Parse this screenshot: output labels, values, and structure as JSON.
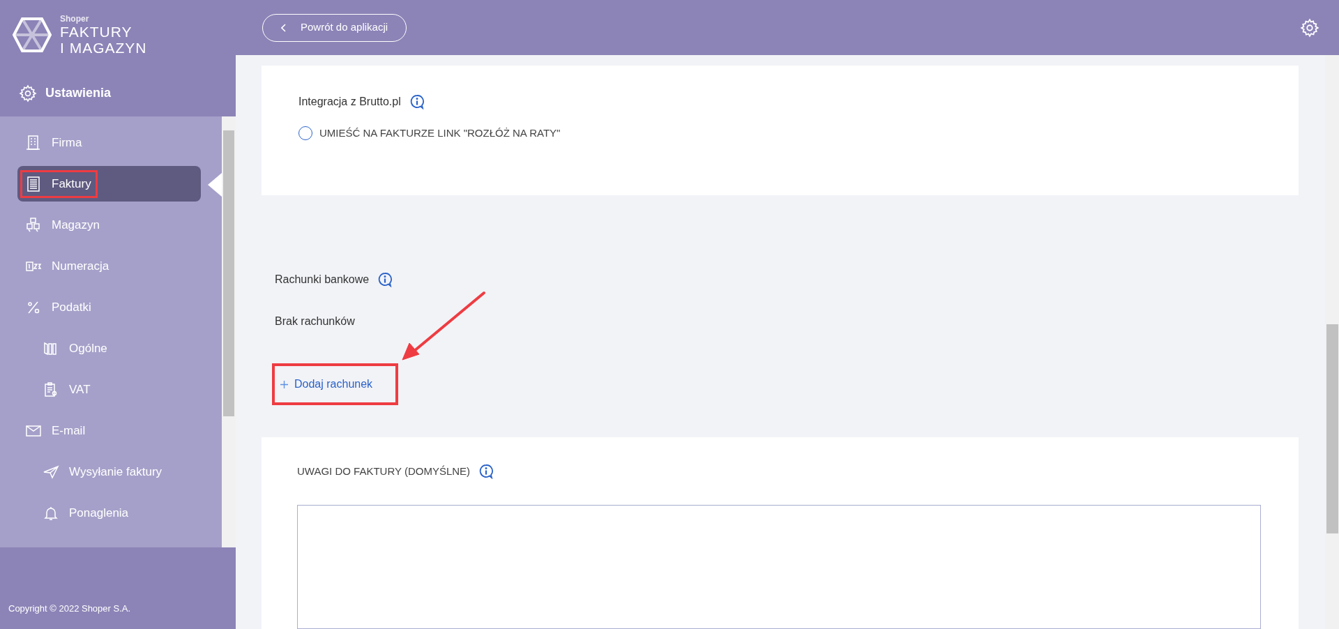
{
  "sidebar": {
    "logo": {
      "brand": "Shoper",
      "title_lines": [
        "FAKTURY",
        "I MAGAZYN"
      ]
    },
    "section": "Ustawienia",
    "items": [
      {
        "label": "Firma",
        "selected": false
      },
      {
        "label": "Faktury",
        "selected": true
      },
      {
        "label": "Magazyn",
        "selected": false
      },
      {
        "label": "Numeracja",
        "selected": false
      },
      {
        "label": "Podatki",
        "selected": false,
        "children": [
          {
            "label": "Ogólne",
            "selected": false
          },
          {
            "label": "VAT",
            "selected": false
          }
        ]
      },
      {
        "label": "E-mail",
        "selected": false,
        "children": [
          {
            "label": "Wysyłanie faktury",
            "selected": false
          },
          {
            "label": "Ponaglenia",
            "selected": false
          }
        ]
      }
    ],
    "copyright": "Copyright © 2022 Shoper S.A."
  },
  "header": {
    "back_button": "Powrót do aplikacji"
  },
  "integration": {
    "title": "Integracja z Brutto.pl",
    "option": {
      "label": "UMIEŚĆ NA FAKTURZE LINK \"ROZŁÓŻ NA RATY\"",
      "checked": false
    }
  },
  "bank_accounts": {
    "title": "Rachunki bankowe",
    "empty_text": "Brak rachunków",
    "add_link": "Dodaj rachunek"
  },
  "notes": {
    "title": "UWAGI DO FAKTURY (DOMYŚLNE)"
  }
}
